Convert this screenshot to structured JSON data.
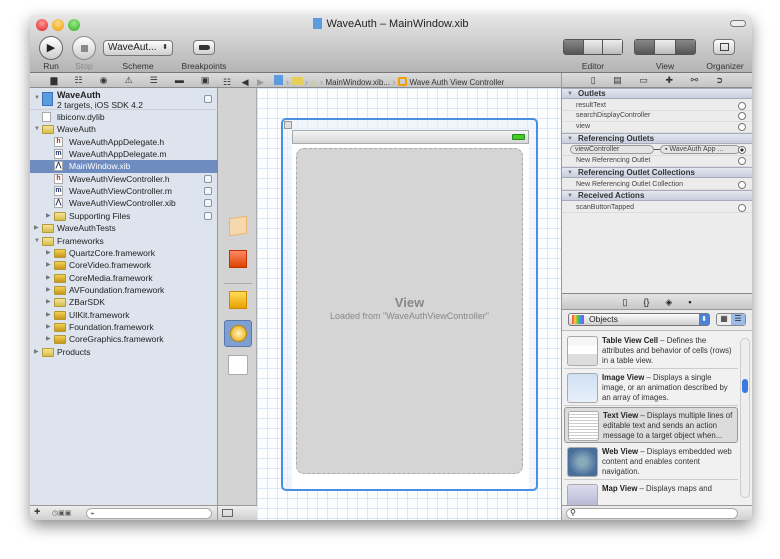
{
  "window": {
    "title": "WaveAuth – MainWindow.xib"
  },
  "toolbar": {
    "run": "Run",
    "stop": "Stop",
    "scheme_value": "WaveAut...",
    "scheme": "Scheme",
    "breakpoints": "Breakpoints",
    "editor": "Editor",
    "view": "View",
    "organizer": "Organizer"
  },
  "jumpbar": {
    "items": [
      "MainWindow.xib...",
      "Wave Auth View Controller"
    ]
  },
  "navigator": {
    "project": {
      "name": "WaveAuth",
      "subtitle": "2 targets, iOS SDK 4.2"
    },
    "items": [
      {
        "label": "libiconv.dylib",
        "type": "file",
        "indent": 1
      },
      {
        "label": "WaveAuth",
        "type": "folder",
        "indent": 1,
        "open": true
      },
      {
        "label": "WaveAuthAppDelegate.h",
        "type": "h",
        "indent": 2
      },
      {
        "label": "WaveAuthAppDelegate.m",
        "type": "m",
        "indent": 2
      },
      {
        "label": "MainWindow.xib",
        "type": "xib",
        "indent": 2,
        "selected": true
      },
      {
        "label": "WaveAuthViewController.h",
        "type": "h",
        "indent": 2,
        "badge": true
      },
      {
        "label": "WaveAuthViewController.m",
        "type": "m",
        "indent": 2,
        "badge": true
      },
      {
        "label": "WaveAuthViewController.xib",
        "type": "xib",
        "indent": 2,
        "badge": true
      },
      {
        "label": "Supporting Files",
        "type": "folder",
        "indent": 2,
        "closed": true,
        "badge": true
      },
      {
        "label": "WaveAuthTests",
        "type": "folder",
        "indent": 1,
        "closed": true
      },
      {
        "label": "Frameworks",
        "type": "folder",
        "indent": 1,
        "open": true
      },
      {
        "label": "QuartzCore.framework",
        "type": "framework",
        "indent": 2,
        "closed": true
      },
      {
        "label": "CoreVideo.framework",
        "type": "framework",
        "indent": 2,
        "closed": true
      },
      {
        "label": "CoreMedia.framework",
        "type": "framework",
        "indent": 2,
        "closed": true
      },
      {
        "label": "AVFoundation.framework",
        "type": "framework",
        "indent": 2,
        "closed": true
      },
      {
        "label": "ZBarSDK",
        "type": "folder",
        "indent": 2,
        "closed": true
      },
      {
        "label": "UIKit.framework",
        "type": "framework",
        "indent": 2,
        "closed": true
      },
      {
        "label": "Foundation.framework",
        "type": "framework",
        "indent": 2,
        "closed": true
      },
      {
        "label": "CoreGraphics.framework",
        "type": "framework",
        "indent": 2,
        "closed": true
      },
      {
        "label": "Products",
        "type": "folder",
        "indent": 1,
        "closed": true
      }
    ]
  },
  "canvas": {
    "view_title": "View",
    "view_subtitle": "Loaded from \"WaveAuthViewController\""
  },
  "inspector": {
    "sections": [
      {
        "title": "Outlets",
        "rows": [
          {
            "label": "resultText"
          },
          {
            "label": "searchDisplayController"
          },
          {
            "label": "view"
          }
        ]
      },
      {
        "title": "Referencing Outlets",
        "rows": [
          {
            "label": "viewController",
            "target": "WaveAuth App ...",
            "connected": true
          },
          {
            "label": "New Referencing Outlet"
          }
        ]
      },
      {
        "title": "Referencing Outlet Collections",
        "rows": [
          {
            "label": "New Referencing Outlet Collection"
          }
        ]
      },
      {
        "title": "Received Actions",
        "rows": [
          {
            "label": "scanButtonTapped"
          }
        ]
      }
    ]
  },
  "library": {
    "popup": "Objects",
    "items": [
      {
        "name": "Table View Cell",
        "desc": " – Defines the attributes and behavior of cells (rows) in a table view."
      },
      {
        "name": "Image View",
        "desc": " – Displays a single image, or an animation described by an array of images."
      },
      {
        "name": "Text View",
        "desc": " – Displays multiple lines of editable text and sends an action message to a target object when..."
      },
      {
        "name": "Web View",
        "desc": " – Displays embedded web content and enables content navigation."
      },
      {
        "name": "Map View",
        "desc": " – Displays maps and"
      }
    ]
  },
  "colors": {
    "selection": "#6f8cc0",
    "accent": "#4a90e2"
  }
}
